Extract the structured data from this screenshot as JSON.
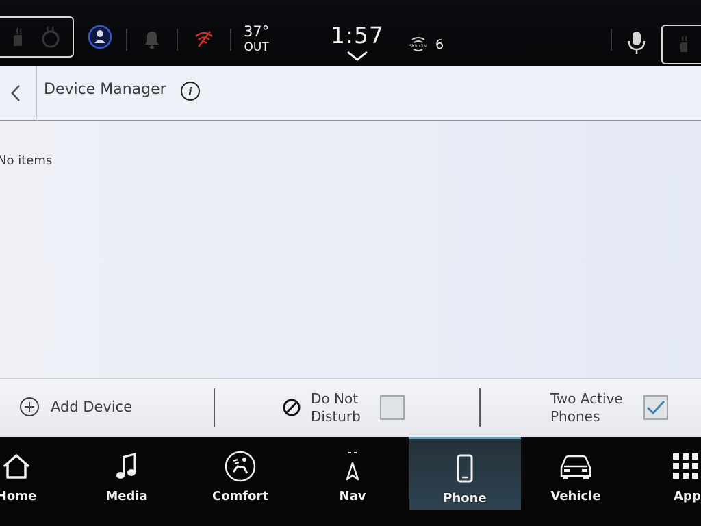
{
  "status_bar": {
    "temperature": "37°",
    "temperature_label": "OUT",
    "time": "1:57",
    "radio_brand": "SiriusXM",
    "radio_channel": "6",
    "icons": [
      "heated-seat-icon",
      "driver-profile-icon",
      "notification-bell-icon",
      "wifi-off-icon",
      "siriusxm-icon",
      "microphone-icon",
      "chevron-down-icon"
    ]
  },
  "header": {
    "title": "Device Manager",
    "info_label": "i"
  },
  "list": {
    "empty_text": "No items"
  },
  "actions": {
    "add_device": "Add Device",
    "do_not_disturb_line1": "Do Not",
    "do_not_disturb_line2": "Disturb",
    "do_not_disturb_checked": false,
    "two_active_line1": "Two Active",
    "two_active_line2": "Phones",
    "two_active_checked": true
  },
  "nav": {
    "items": [
      {
        "label": "Home",
        "icon": "home-icon"
      },
      {
        "label": "Media",
        "icon": "music-note-icon"
      },
      {
        "label": "Comfort",
        "icon": "climate-seat-icon"
      },
      {
        "label": "Nav",
        "icon": "navigation-arrow-icon"
      },
      {
        "label": "Phone",
        "icon": "phone-icon",
        "active": true
      },
      {
        "label": "Vehicle",
        "icon": "car-icon"
      },
      {
        "label": "Apps",
        "icon": "apps-grid-icon"
      }
    ]
  },
  "colors": {
    "active_tab": "#2e4250",
    "check_accent": "#3d86b0",
    "panel_bg": "#eef0f6"
  }
}
